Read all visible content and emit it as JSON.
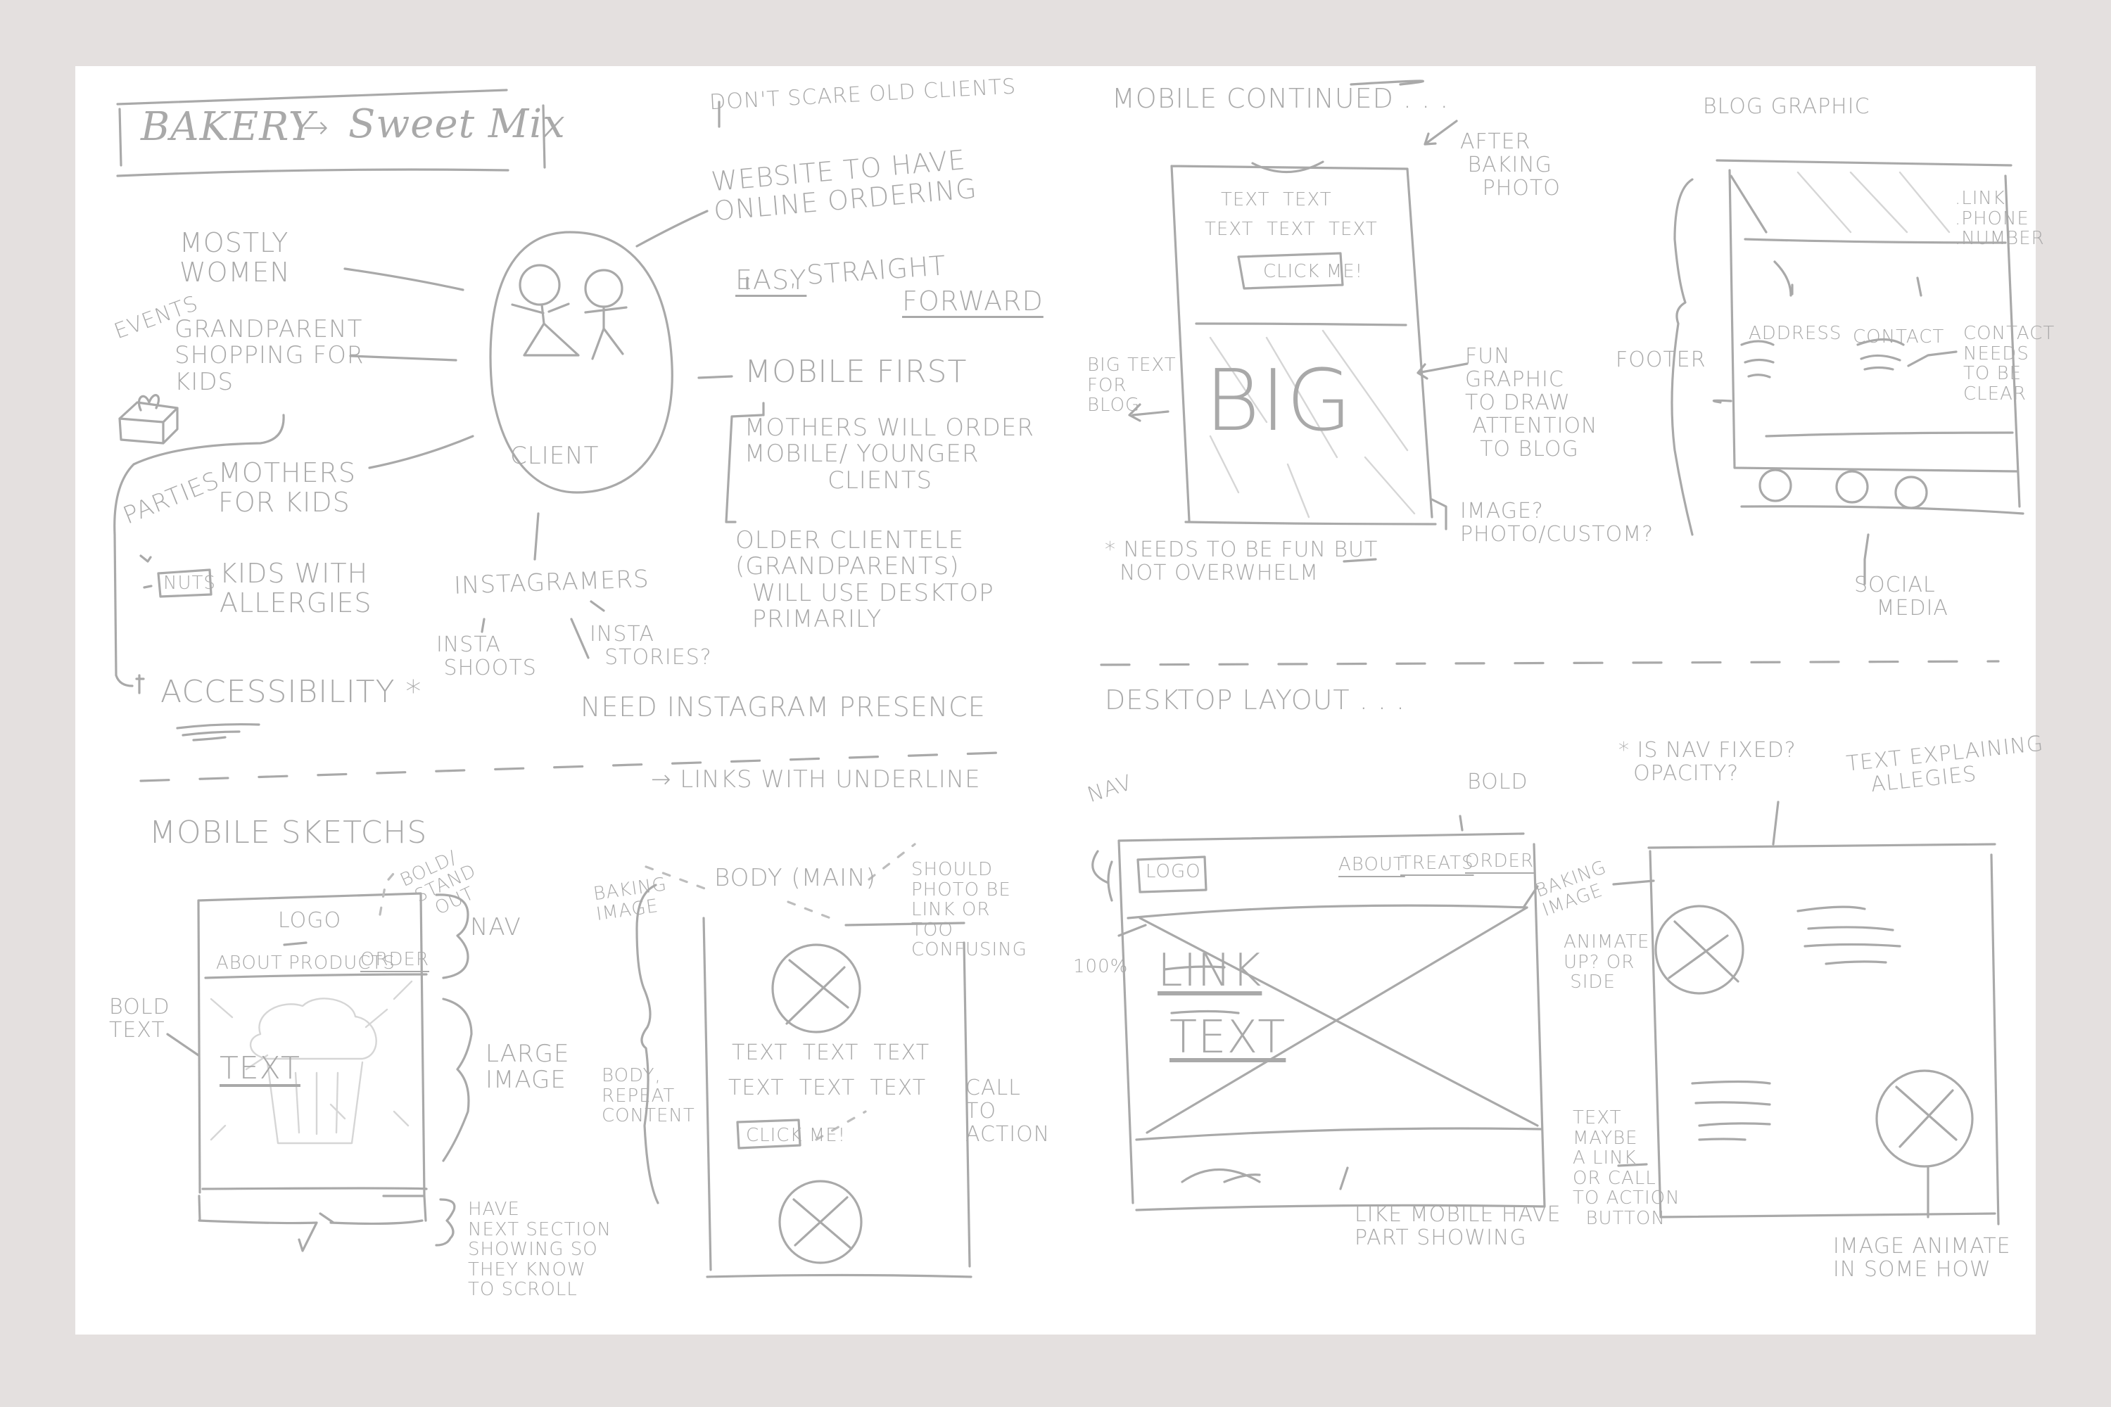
{
  "title": {
    "left": "BAKERY",
    "arrow": "→",
    "right": "Sweet Mix"
  },
  "mindmap": {
    "center": "CLIENT",
    "audience": [
      {
        "text": "MOSTLY\nWOMEN"
      },
      {
        "text": "GRANDPARENT\nSHOPPING FOR\nKIDS",
        "tag": "EVENTS"
      },
      {
        "text": "MOTHERS\nFOR KIDS",
        "tag": "PARTIES"
      },
      {
        "text": "KIDS WITH\nALLERGIES",
        "tag": "NUTS"
      }
    ],
    "accessibility": "ACCESSIBILITY *",
    "requirements": {
      "top_note": "DON'T SCARE OLD CLIENTS",
      "ordering": "WEBSITE TO HAVE\nONLINE ORDERING",
      "easy": "EASY",
      "straight": ", STRAIGHT",
      "forward": "FORWARD"
    },
    "mobile_first": {
      "heading": "MOBILE FIRST",
      "mothers": "MOTHERS WILL ORDER\nMOBILE/ YOUNGER\n          CLIENTS",
      "older": "OLDER CLIENTELE\n(GRANDPARENTS)\n  WILL USE DESKTOP\n  PRIMARILY"
    },
    "instagram": {
      "heading": "INSTAGRAMERS",
      "shoots": "INSTA\n SHOOTS",
      "stories": "INSTA\n  STORIES?",
      "need": "NEED INSTAGRAM PRESENCE"
    },
    "links_note": "→ LINKS WITH UNDERLINE"
  },
  "mobile_sketches": {
    "heading": "MOBILE SKETCHS",
    "phone1": {
      "logo": "LOGO",
      "nav_items": [
        "ABOUT",
        "PRODUCTS",
        "ORDER"
      ],
      "hero_text": "TEXT",
      "notes": {
        "bold_standout": "BOLD/\n STAND\n   OUT",
        "nav": "NAV",
        "bold_text": "BOLD\nTEXT",
        "large_image": "LARGE\nIMAGE",
        "next_section": "HAVE\nNEXT SECTION\nSHOWING SO\nTHEY KNOW\nTO SCROLL"
      }
    },
    "phone2": {
      "heading": "BODY (MAIN)",
      "text_lines": [
        "TEXT  TEXT  TEXT",
        "TEXT  TEXT  TEXT"
      ],
      "button": "CLICK ME!",
      "notes": {
        "baking_image": "BAKING\nIMAGE",
        "photo_link": "SHOULD\nPHOTO BE\nLINK OR\nTOO\nCONFUSING",
        "body_repeat": "BODY,\nREPEAT\nCONTENT",
        "cta": "CALL\nTO\nACTION"
      }
    }
  },
  "mobile_continued": {
    "heading": "MOBILE CONTINUED . . .",
    "text_lines": [
      "TEXT  TEXT",
      "TEXT  TEXT  TEXT"
    ],
    "button": "CLICK ME!",
    "big": "BIG",
    "notes": {
      "after_baking": "AFTER\n BAKING\n   PHOTO",
      "big_text": "BIG TEXT\nFOR\nBLOG",
      "fun_graphic": "FUN\nGRAPHIC\nTO DRAW\n ATTENTION\n  TO BLOG",
      "image": "IMAGE?\nPHOTO/CUSTOM?",
      "needs_fun": "* NEEDS TO BE FUN BUT\n  NOT OVERWHELM",
      "needs_fun_underline": "BUT"
    }
  },
  "footer_sketch": {
    "blog_graphic": "BLOG GRAPHIC",
    "address": "ADDRESS",
    "contact": "CONTACT",
    "footer_label": "FOOTER",
    "side_notes": ".LINK\n.PHONE\n.NUMBER",
    "contact_note": "CONTACT\nNEEDS\nTO BE\nCLEAR",
    "social": "SOCIAL\n   MEDIA"
  },
  "desktop": {
    "heading": "DESKTOP LAYOUT . . .",
    "logo": "LOGO",
    "nav_items": [
      "ABOUT",
      "TREATS",
      "ORDER"
    ],
    "hero_link": "LINK",
    "hero_text": "TEXT",
    "notes": {
      "nav": "NAV",
      "bold": "BOLD",
      "baking_image": "BAKING\nIMAGE",
      "width": "100%",
      "like_mobile": "LIKE MOBILE HAVE\nPART SHOWING",
      "nav_fixed": "* IS NAV FIXED?\n  OPACITY?",
      "allergies": "TEXT EXPLAINING\n   ALLEGIES",
      "animate": "ANIMATE\nUP? OR\n SIDE",
      "text_maybe": "TEXT\nMAYBE\nA LINK\nOR CALL\nTO ACTION\n  BUTTON",
      "image_animate": "IMAGE ANIMATE\nIN SOME HOW"
    }
  }
}
